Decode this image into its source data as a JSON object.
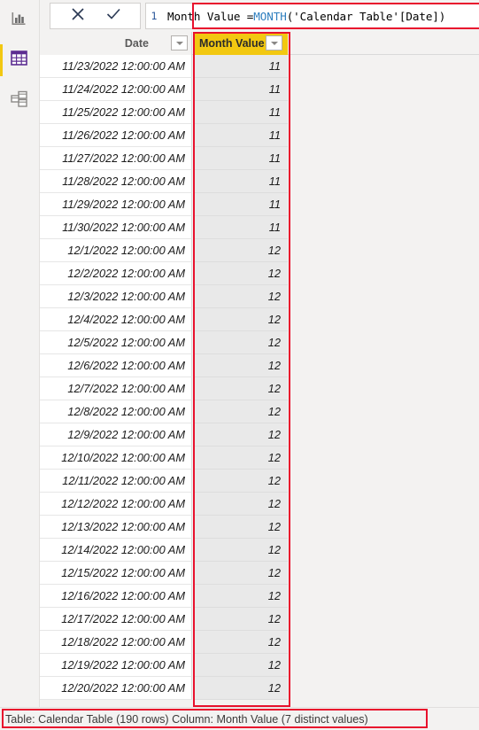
{
  "sidebar": {
    "items": [
      {
        "name": "report-view",
        "icon": "bar-chart-icon",
        "label": "Report",
        "selected": false
      },
      {
        "name": "data-view",
        "icon": "table-grid-icon",
        "label": "Data",
        "selected": true
      },
      {
        "name": "model-view",
        "icon": "model-relationships-icon",
        "label": "Model",
        "selected": false
      }
    ],
    "accent_color": "#F2C811"
  },
  "formula_bar": {
    "line_number": "1",
    "cancel_label": "Cancel",
    "accept_label": "Accept",
    "cancel_icon": "close-x-icon",
    "accept_icon": "checkmark-icon",
    "full_text": "Month Value = MONTH('Calendar Table'[Date])",
    "tokens": {
      "prefix": "Month Value = ",
      "function": "MONTH",
      "suffix": "('Calendar Table'[Date])"
    },
    "function_color": "#2F7FBF"
  },
  "grid": {
    "columns": [
      {
        "header": "Date",
        "name": "column-date",
        "selected": false
      },
      {
        "header": "Month Value",
        "name": "column-month-value",
        "selected": true
      }
    ],
    "selected_header_color": "#F2C811",
    "selected_column_color": "#E9E9E9",
    "rows": [
      {
        "date": "11/23/2022 12:00:00 AM",
        "month_value": "11"
      },
      {
        "date": "11/24/2022 12:00:00 AM",
        "month_value": "11"
      },
      {
        "date": "11/25/2022 12:00:00 AM",
        "month_value": "11"
      },
      {
        "date": "11/26/2022 12:00:00 AM",
        "month_value": "11"
      },
      {
        "date": "11/27/2022 12:00:00 AM",
        "month_value": "11"
      },
      {
        "date": "11/28/2022 12:00:00 AM",
        "month_value": "11"
      },
      {
        "date": "11/29/2022 12:00:00 AM",
        "month_value": "11"
      },
      {
        "date": "11/30/2022 12:00:00 AM",
        "month_value": "11"
      },
      {
        "date": "12/1/2022 12:00:00 AM",
        "month_value": "12"
      },
      {
        "date": "12/2/2022 12:00:00 AM",
        "month_value": "12"
      },
      {
        "date": "12/3/2022 12:00:00 AM",
        "month_value": "12"
      },
      {
        "date": "12/4/2022 12:00:00 AM",
        "month_value": "12"
      },
      {
        "date": "12/5/2022 12:00:00 AM",
        "month_value": "12"
      },
      {
        "date": "12/6/2022 12:00:00 AM",
        "month_value": "12"
      },
      {
        "date": "12/7/2022 12:00:00 AM",
        "month_value": "12"
      },
      {
        "date": "12/8/2022 12:00:00 AM",
        "month_value": "12"
      },
      {
        "date": "12/9/2022 12:00:00 AM",
        "month_value": "12"
      },
      {
        "date": "12/10/2022 12:00:00 AM",
        "month_value": "12"
      },
      {
        "date": "12/11/2022 12:00:00 AM",
        "month_value": "12"
      },
      {
        "date": "12/12/2022 12:00:00 AM",
        "month_value": "12"
      },
      {
        "date": "12/13/2022 12:00:00 AM",
        "month_value": "12"
      },
      {
        "date": "12/14/2022 12:00:00 AM",
        "month_value": "12"
      },
      {
        "date": "12/15/2022 12:00:00 AM",
        "month_value": "12"
      },
      {
        "date": "12/16/2022 12:00:00 AM",
        "month_value": "12"
      },
      {
        "date": "12/17/2022 12:00:00 AM",
        "month_value": "12"
      },
      {
        "date": "12/18/2022 12:00:00 AM",
        "month_value": "12"
      },
      {
        "date": "12/19/2022 12:00:00 AM",
        "month_value": "12"
      },
      {
        "date": "12/20/2022 12:00:00 AM",
        "month_value": "12"
      }
    ]
  },
  "status_bar": {
    "text": "Table: Calendar Table (190 rows) Column: Month Value (7 distinct values)"
  },
  "annotations": {
    "color": "#E8112D",
    "regions": [
      "formula-bar",
      "month-value-column",
      "status-bar"
    ]
  }
}
